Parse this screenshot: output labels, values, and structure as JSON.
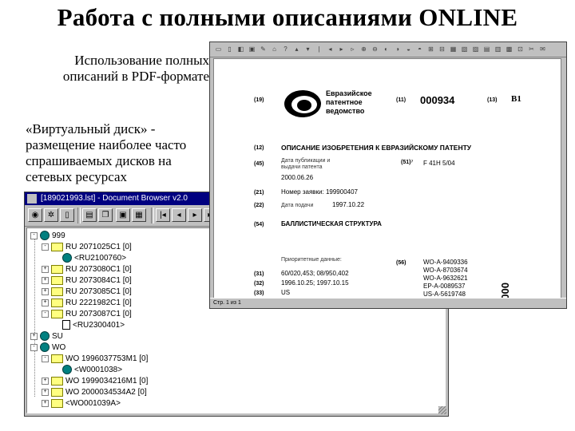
{
  "slide": {
    "title": "Работа с полными описаниями ONLINE",
    "bullet1": "Использование полных описаний в PDF-формате",
    "bullet2": "«Виртуальный диск» - размещение наиболее часто спрашиваемых дисков на сетевых ресурсах"
  },
  "browser": {
    "title": "[189021993.lst] - Document Browser v2.0",
    "tree": [
      {
        "label": "999",
        "icon": "globe",
        "expander": "-"
      },
      {
        "label": "RU   2071025C1 [0]",
        "icon": "folder",
        "expander": "-"
      },
      {
        "label": "<RU2100760>",
        "icon": "globe",
        "expander": ""
      },
      {
        "label": "RU   2073080C1 [0]",
        "icon": "folder",
        "expander": "+"
      },
      {
        "label": "RU   2073084C1 [0]",
        "icon": "folder",
        "expander": "+"
      },
      {
        "label": "RU   2073085C1 [0]",
        "icon": "folder",
        "expander": "+"
      },
      {
        "label": "RU   2221982C1 [0]",
        "icon": "folder",
        "expander": "+"
      },
      {
        "label": "RU   2073087C1 [0]",
        "icon": "folder",
        "expander": "-"
      },
      {
        "label": "<RU2300401>",
        "icon": "doc",
        "expander": ""
      },
      {
        "label": "SU",
        "icon": "globe",
        "expander": "+"
      },
      {
        "label": "WO",
        "icon": "globe",
        "expander": "-"
      },
      {
        "label": "WO 1996037753M1 [0]",
        "icon": "folder",
        "expander": "-"
      },
      {
        "label": "<W0001038>",
        "icon": "globe",
        "expander": ""
      },
      {
        "label": "WO 1999034216M1 [0]",
        "icon": "folder",
        "expander": "+"
      },
      {
        "label": "WO 2000034534A2 [0]",
        "icon": "folder",
        "expander": "+"
      },
      {
        "label": "<WO001039A>",
        "icon": "folder",
        "expander": "+"
      }
    ]
  },
  "pdf": {
    "status": "Стр. 1 из 1",
    "patent": {
      "code19": "(19)",
      "office": "Евразийское патентное ведомство",
      "code11": "(11)",
      "number": "000934",
      "code13": "(13)",
      "kind": "B1",
      "code12": "(12)",
      "heading": "ОПИСАНИЕ ИЗОБРЕТЕНИЯ К ЕВРАЗИЙСКОМУ ПАТЕНТУ",
      "code45": "(45)",
      "label45": "Дата публикации и выдачи патента",
      "code51": "(51)⁷",
      "ipc": "F 41H 5/04",
      "date45": "2000.06.26",
      "code21": "(21)",
      "label21": "Номер заявки: 199900407",
      "code22": "(22)",
      "label22": "Дата подачи",
      "date22": "1997.10.22",
      "code54": "(54)",
      "invention": "БАЛЛИСТИЧЕСКАЯ СТРУКТУРА",
      "priority_label": "Приоритетные данные:",
      "code31": "(31)",
      "priority_nums": "60/020,453; 08/950,402",
      "code32": "(32)",
      "priority_dates": "1996.10.25; 1997.10.15",
      "code33": "(33)",
      "country": "US",
      "code56": "(56)",
      "citations": [
        "WO-A-9409336",
        "WO-A-8703674",
        "WO-A-9632621",
        "EP-A-0089537",
        "US-A-5619748"
      ],
      "vertical_number": "000934"
    }
  }
}
